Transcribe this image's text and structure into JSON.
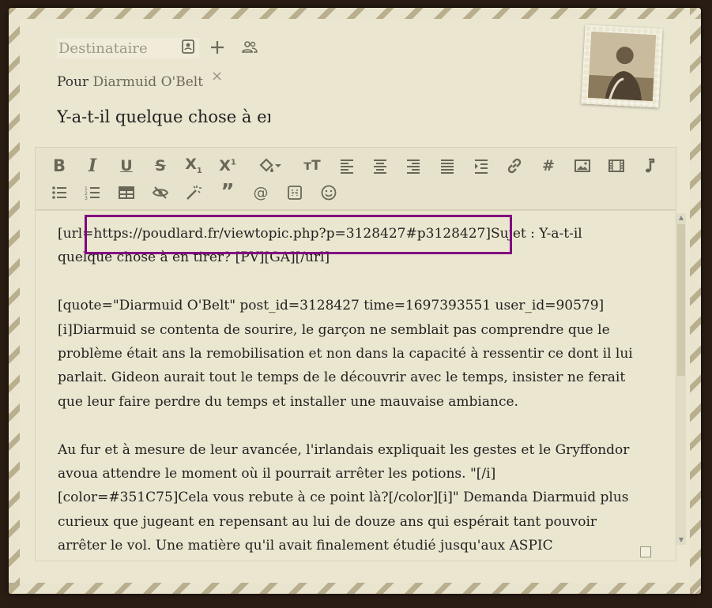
{
  "header": {
    "recipient_placeholder": "Destinataire",
    "pour_label": "Pour",
    "recipient_name": "Diarmuid O'Belt",
    "remove_symbol": "×",
    "subject": "Y-a-t-il quelque chose à en tirer? [PV][GA]"
  },
  "toolbar": {
    "row1": [
      "bold",
      "italic",
      "underline",
      "strikethrough",
      "subscript",
      "superscript",
      "fill-color",
      "font-size",
      "align-left",
      "align-center",
      "align-right",
      "align-justify",
      "indent",
      "link",
      "hashtag",
      "image",
      "video",
      "music"
    ],
    "row2": [
      "bullet-list",
      "numbered-list",
      "table",
      "hide",
      "magic-wand",
      "quote",
      "mention",
      "code",
      "emoji"
    ]
  },
  "editor": {
    "content": "[url=https://poudlard.fr/viewtopic.php?p=3128427#p3128427]Sujet : Y-a-t-il quelque chose à en tirer? [PV][GA][/url]\n\n[quote=\"Diarmuid O'Belt\" post_id=3128427 time=1697393551 user_id=90579]\n[i]Diarmuid se contenta de sourire, le garçon ne semblait pas comprendre que le problème était ans la remobilisation et non dans la capacité à ressentir ce dont il lui parlait. Gideon aurait tout le temps de le découvrir avec le temps, insister ne ferait que leur faire perdre du temps et installer une mauvaise ambiance.\n\nAu fur et à mesure de leur avancée, l'irlandais expliquait les gestes et le Gryffondor avoua attendre le moment où il pourrait arrêter les potions. \"[/i]\n[color=#351C75]Cela vous rebute à ce point là?[/color][i]\" Demanda Diarmuid plus curieux que jugeant en repensant au lui de douze ans qui espérait tant pouvoir arrêter le vol. Une matière qu'il avait finalement étudié jusqu'aux ASPIC"
  },
  "colors": {
    "highlight": "#800080",
    "background": "#ebe6cf",
    "stripe": "#b9ae8e"
  }
}
